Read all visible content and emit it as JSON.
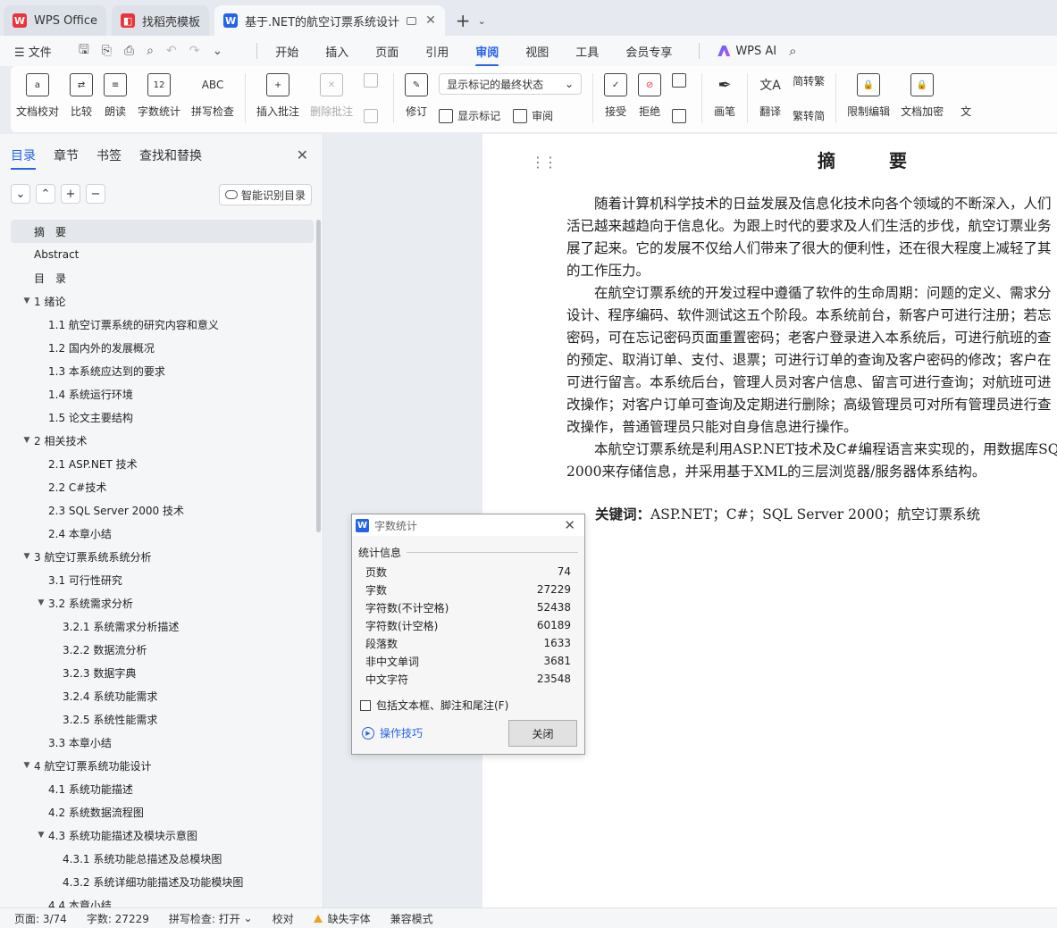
{
  "tabs": [
    {
      "label": "WPS Office",
      "icon": "wps-logo-icon"
    },
    {
      "label": "找稻壳模板",
      "icon": "docer-icon"
    },
    {
      "label": "基于.NET的航空订票系统设计",
      "icon": "writer-icon"
    }
  ],
  "menu": {
    "file": "文件",
    "items": [
      "开始",
      "插入",
      "页面",
      "引用",
      "审阅",
      "视图",
      "工具",
      "会员专享"
    ],
    "active": "审阅",
    "ai": "WPS AI"
  },
  "ribbon": {
    "doc_check": "文档校对",
    "compare": "比较",
    "read_aloud": "朗读",
    "word_count": "字数统计",
    "word_count_icon_text": "12",
    "spell_check": "拼写检查",
    "spell_icon_text": "ABC",
    "insert_comment": "插入批注",
    "delete_comment": "删除批注",
    "revise": "修订",
    "markup_select": "显示标记的最终状态",
    "show_markup": "显示标记",
    "review": "审阅",
    "accept": "接受",
    "reject": "拒绝",
    "pen": "画笔",
    "translate": "翻译",
    "to_traditional": "简转繁",
    "to_simplified": "繁转简",
    "restrict_edit": "限制编辑",
    "doc_encrypt": "文档加密",
    "doc_more": "文"
  },
  "nav": {
    "tabs": [
      "目录",
      "章节",
      "书签",
      "查找和替换"
    ],
    "smart_btn": "智能识别目录",
    "toc": [
      {
        "label": "摘　要",
        "level": 0,
        "selected": true
      },
      {
        "label": "Abstract",
        "level": 0
      },
      {
        "label": "目　录",
        "level": 0
      },
      {
        "label": "1  绪论",
        "level": 0,
        "arrow": true
      },
      {
        "label": "1.1  航空订票系统的研究内容和意义",
        "level": 1
      },
      {
        "label": "1.2  国内外的发展概况",
        "level": 1
      },
      {
        "label": "1.3  本系统应达到的要求",
        "level": 1
      },
      {
        "label": "1.4  系统运行环境",
        "level": 1
      },
      {
        "label": "1.5  论文主要结构",
        "level": 1
      },
      {
        "label": "2  相关技术",
        "level": 0,
        "arrow": true
      },
      {
        "label": "2.1 ASP.NET 技术",
        "level": 1
      },
      {
        "label": "2.2 C#技术",
        "level": 1
      },
      {
        "label": "2.3 SQL Server 2000 技术",
        "level": 1
      },
      {
        "label": "2.4  本章小结",
        "level": 1
      },
      {
        "label": "3  航空订票系统系统分析",
        "level": 0,
        "arrow": true
      },
      {
        "label": "3.1  可行性研究",
        "level": 1
      },
      {
        "label": "3.2  系统需求分析",
        "level": 1,
        "arrow": true
      },
      {
        "label": "3.2.1  系统需求分析描述",
        "level": 2
      },
      {
        "label": "3.2.2  数据流分析",
        "level": 2
      },
      {
        "label": "3.2.3  数据字典",
        "level": 2
      },
      {
        "label": "3.2.4  系统功能需求",
        "level": 2
      },
      {
        "label": "3.2.5  系统性能需求",
        "level": 2
      },
      {
        "label": "3.3  本章小结",
        "level": 1
      },
      {
        "label": "4  航空订票系统功能设计",
        "level": 0,
        "arrow": true
      },
      {
        "label": "4.1  系统功能描述",
        "level": 1
      },
      {
        "label": "4.2  系统数据流程图",
        "level": 1
      },
      {
        "label": "4.3  系统功能描述及模块示意图",
        "level": 1,
        "arrow": true
      },
      {
        "label": "4.3.1  系统功能总描述及总模块图",
        "level": 2
      },
      {
        "label": "4.3.2  系统详细功能描述及功能模块图",
        "level": 2
      },
      {
        "label": "4.4  本章小结",
        "level": 1
      }
    ]
  },
  "doc": {
    "title": "摘　要",
    "paragraphs": [
      [
        "　　随着计算机科学技术的日益发展及信息化技术向各个领域的不断深入，人们",
        "活已越来越趋向于信息化。为跟上时代的要求及人们生活的步伐，航空订票业务",
        "展了起来。它的发展不仅给人们带来了很大的便利性，还在很大程度上减轻了其",
        "的工作压力。"
      ],
      [
        "　　在航空订票系统的开发过程中遵循了软件的生命周期：问题的定义、需求分",
        "设计、程序编码、软件测试这五个阶段。本系统前台，新客户可进行注册；若忘",
        "密码，可在忘记密码页面重置密码；老客户登录进入本系统后，可进行航班的查",
        "的预定、取消订单、支付、退票；可进行订单的查询及客户密码的修改；客户在",
        "可进行留言。本系统后台，管理人员对客户信息、留言可进行查询；对航班可进",
        "改操作；对客户订单可查询及定期进行删除；高级管理员可对所有管理员进行查",
        "改操作，普通管理员只能对自身信息进行操作。"
      ],
      [
        "　　本航空订票系统是利用ASP.NET技术及C#编程语言来实现的，用数据库SQ",
        "2000来存储信息，并采用基于XML的三层浏览器/服务器体系结构。"
      ]
    ],
    "keywords_label": "关键词：",
    "keywords": "ASP.NET；C#；SQL Server 2000；航空订票系统"
  },
  "dialog": {
    "title": "字数统计",
    "section": "统计信息",
    "stats": [
      {
        "label": "页数",
        "value": "74"
      },
      {
        "label": "字数",
        "value": "27229"
      },
      {
        "label": "字符数(不计空格)",
        "value": "52438"
      },
      {
        "label": "字符数(计空格)",
        "value": "60189"
      },
      {
        "label": "段落数",
        "value": "1633"
      },
      {
        "label": "非中文单词",
        "value": "3681"
      },
      {
        "label": "中文字符",
        "value": "23548"
      }
    ],
    "checkbox": "包括文本框、脚注和尾注(F)",
    "tips": "操作技巧",
    "close": "关闭"
  },
  "status": {
    "page": "页面: 3/74",
    "words": "字数: 27229",
    "spell": "拼写检查: 打开",
    "proof": "校对",
    "missing_font": "缺失字体",
    "compat": "兼容模式"
  },
  "colors": {
    "accent": "#2463eb",
    "wps_red": "#e8343a"
  }
}
